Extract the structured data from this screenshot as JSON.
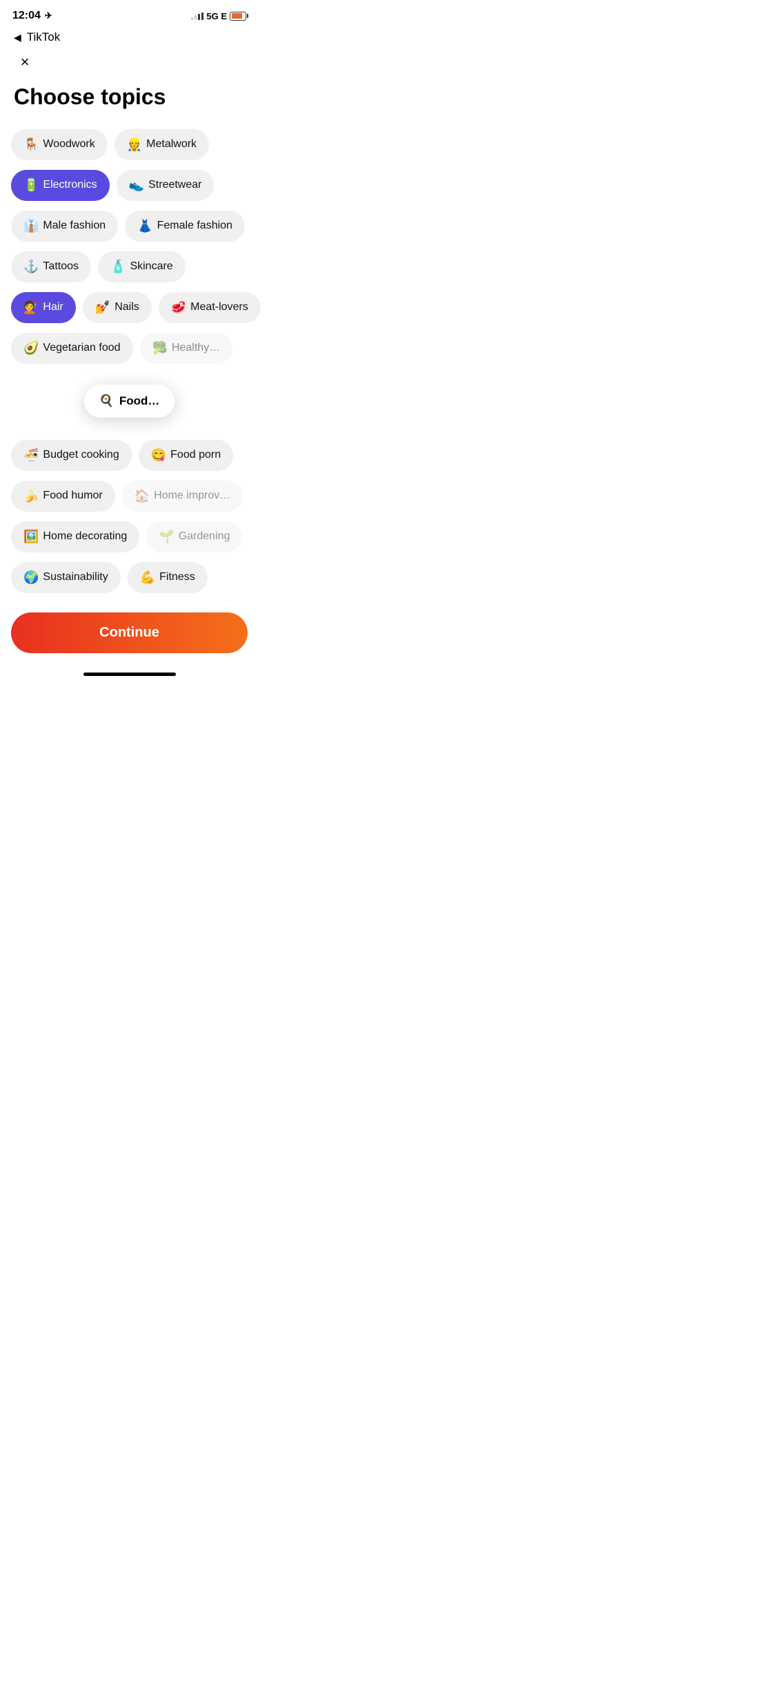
{
  "statusBar": {
    "time": "12:04",
    "network": "5G E",
    "backLabel": "TikTok"
  },
  "header": {
    "title": "Choose topics",
    "closeLabel": "×"
  },
  "topics": [
    {
      "row": 1,
      "chips": [
        {
          "id": "woodwork",
          "label": "Woodwork",
          "emoji": "🪑",
          "selected": false
        },
        {
          "id": "metalwork",
          "label": "Metalwork",
          "emoji": "👷",
          "selected": false
        }
      ]
    },
    {
      "row": 2,
      "chips": [
        {
          "id": "electronics",
          "label": "Electronics",
          "emoji": "🔋",
          "selected": true
        },
        {
          "id": "streetwear",
          "label": "Streetwear",
          "emoji": "👟",
          "selected": false
        }
      ]
    },
    {
      "row": 3,
      "chips": [
        {
          "id": "male-fashion",
          "label": "Male fashion",
          "emoji": "👔",
          "selected": false
        },
        {
          "id": "female-fashion",
          "label": "Female fashion",
          "emoji": "👗",
          "selected": false
        }
      ]
    },
    {
      "row": 4,
      "chips": [
        {
          "id": "tattoos",
          "label": "Tattoos",
          "emoji": "⚓",
          "selected": false
        },
        {
          "id": "skincare",
          "label": "Skincare",
          "emoji": "🧴",
          "selected": false
        }
      ]
    },
    {
      "row": 5,
      "chips": [
        {
          "id": "hair",
          "label": "Hair",
          "emoji": "💇",
          "selected": true
        },
        {
          "id": "nails",
          "label": "Nails",
          "emoji": "💅",
          "selected": false
        },
        {
          "id": "meat-lovers",
          "label": "Meat-lovers",
          "emoji": "🥩",
          "selected": false
        }
      ]
    },
    {
      "row": 6,
      "chips": [
        {
          "id": "vegetarian-food",
          "label": "Vegetarian food",
          "emoji": "🥑",
          "selected": false
        },
        {
          "id": "healthy-eating",
          "label": "Healthy eating",
          "emoji": "🥦",
          "selected": false,
          "partial": true
        }
      ]
    }
  ],
  "popupRow": {
    "icon": "🍳",
    "label": "F..."
  },
  "bottomRows": [
    {
      "chips": [
        {
          "id": "budget-cooking",
          "label": "Budget cooking",
          "emoji": "🍜",
          "selected": false
        },
        {
          "id": "food-porn",
          "label": "Food porn",
          "emoji": "😋",
          "selected": false
        }
      ]
    },
    {
      "chips": [
        {
          "id": "food-humor",
          "label": "Food humor",
          "emoji": "🍌",
          "selected": false
        },
        {
          "id": "home-improvement",
          "label": "Home improvement",
          "emoji": "🏠",
          "selected": false,
          "partial": true
        }
      ]
    },
    {
      "chips": [
        {
          "id": "home-decorating",
          "label": "Home decorating",
          "emoji": "🖼️",
          "selected": false
        },
        {
          "id": "gardening",
          "label": "Gardening",
          "emoji": "🌱",
          "selected": false,
          "partial": true
        }
      ]
    },
    {
      "chips": [
        {
          "id": "sustainability",
          "label": "Sustainability",
          "emoji": "🌍",
          "selected": false
        },
        {
          "id": "fitness",
          "label": "Fitness",
          "emoji": "💪",
          "selected": false
        }
      ]
    }
  ],
  "continueButton": {
    "label": "Continue"
  }
}
